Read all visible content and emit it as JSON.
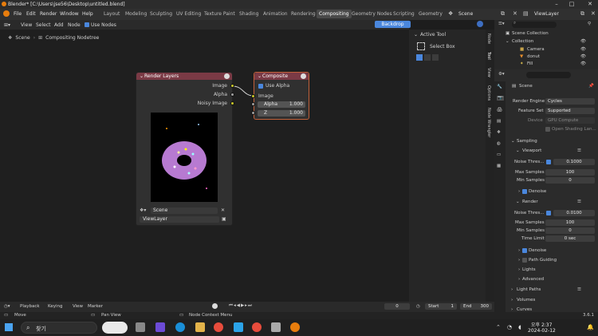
{
  "window": {
    "title": "Blender* [C:\\Users\\jse56\\Desktop\\untitled.blend]",
    "min": "–",
    "max": "□",
    "close": "✕"
  },
  "menu": [
    "File",
    "Edit",
    "Render",
    "Window",
    "Help"
  ],
  "workspaces": [
    "Layout",
    "Modeling",
    "Sculpting",
    "UV Editing",
    "Texture Paint",
    "Shading",
    "Animation",
    "Rendering",
    "Compositing",
    "Geometry Nodes",
    "Scripting",
    "Geometry"
  ],
  "scene": "Scene",
  "viewlayer": "ViewLayer",
  "editor_header": {
    "view": "View",
    "select": "Select",
    "add": "Add",
    "node": "Node",
    "use_nodes": "Use Nodes",
    "backdrop": "Backdrop"
  },
  "breadcrumb": {
    "scene": "Scene",
    "tree": "Compositing Nodetree"
  },
  "render_layers_node": {
    "title": "Render Layers",
    "outputs": [
      "Image",
      "Alpha",
      "Noisy Image"
    ],
    "scene": "Scene",
    "layer": "ViewLayer"
  },
  "composite_node": {
    "title": "Composite",
    "use_alpha": "Use Alpha",
    "image": "Image",
    "alpha_label": "Alpha",
    "alpha_value": "1.000",
    "z_label": "Z",
    "z_value": "1.000"
  },
  "tool_panel": {
    "title": "Active Tool",
    "tool": "Select Box"
  },
  "side_tabs": [
    "Node",
    "Tool",
    "View",
    "Options",
    "Node Wrangler"
  ],
  "outliner": {
    "root": "Scene Collection",
    "collection": "Collection",
    "items": [
      "Camera",
      "donut",
      "Fill"
    ]
  },
  "properties": {
    "scene": "Scene",
    "render_engine_label": "Render Engine",
    "render_engine": "Cycles",
    "feature_set_label": "Feature Set",
    "feature_set": "Supported",
    "device_label": "Device",
    "device": "GPU Compute",
    "osl": "Open Shading Lan...",
    "sampling": "Sampling",
    "viewport": "Viewport",
    "noise_threshold_label": "Noise Thres...",
    "viewport_noise": "0.1000",
    "max_samples_label": "Max Samples",
    "viewport_max": "100",
    "min_samples_label": "Min Samples",
    "viewport_min": "0",
    "denoise": "Denoise",
    "render": "Render",
    "render_noise": "0.0100",
    "render_max": "100",
    "render_min": "0",
    "time_limit_label": "Time Limit",
    "time_limit": "0 sec",
    "render_denoise": "Denoise",
    "path_guiding": "Path Guiding",
    "lights": "Lights",
    "advanced": "Advanced",
    "light_paths": "Light Paths",
    "volumes": "Volumes",
    "curves": "Curves"
  },
  "timeline": {
    "playback": "Playback",
    "keying": "Keying",
    "view": "View",
    "marker": "Marker",
    "frame": "0",
    "start_label": "Start",
    "start": "1",
    "end_label": "End",
    "end": "300"
  },
  "statusbar": {
    "move": "Move",
    "pan": "Pan View",
    "context": "Node Context Menu",
    "version": "3.6.1"
  },
  "taskbar": {
    "search": "찾기",
    "time": "오후 2:37",
    "date": "2024-02-12"
  },
  "colors": {
    "node_header": "#7a3a45",
    "accent": "#4a87dd",
    "socket_yellow": "#c9c72b"
  }
}
